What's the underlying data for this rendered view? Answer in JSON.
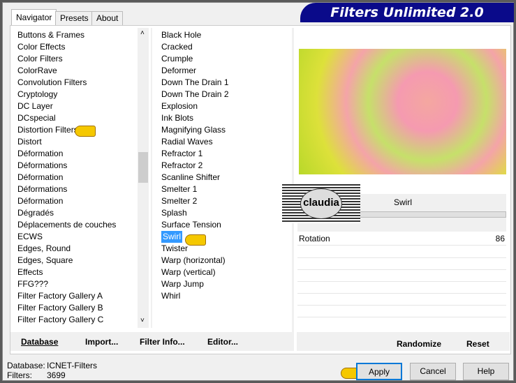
{
  "title": "Filters Unlimited 2.0",
  "tabs": [
    "Navigator",
    "Presets",
    "About"
  ],
  "categories": [
    "Buttons & Frames",
    "Color Effects",
    "Color Filters",
    "ColorRave",
    "Convolution Filters",
    "Cryptology",
    "DC Layer",
    "DCspecial",
    "Distortion Filters",
    "Distort",
    "Déformation",
    "Déformations",
    "Déformation",
    "Déformations",
    "Déformation",
    "Dégradés",
    "Déplacements de couches",
    "ECWS",
    "Edges, Round",
    "Edges, Square",
    "Effects",
    "FFG???",
    "Filter Factory Gallery A",
    "Filter Factory Gallery B",
    "Filter Factory Gallery C"
  ],
  "filters": [
    "Black Hole",
    "Cracked",
    "Crumple",
    "Deformer",
    "Down The Drain 1",
    "Down The Drain 2",
    "Explosion",
    "Ink Blots",
    "Magnifying Glass",
    "Radial Waves",
    "Refractor 1",
    "Refractor 2",
    "Scanline Shifter",
    "Smelter 1",
    "Smelter 2",
    "Splash",
    "Surface Tension",
    "Swirl",
    "Twister",
    "Warp (horizontal)",
    "Warp (vertical)",
    "Warp Jump",
    "Whirl"
  ],
  "selected_filter_index": 17,
  "filter_name": "Swirl",
  "params": [
    {
      "label": "Rotation",
      "value": "86"
    }
  ],
  "watermark": "claudia",
  "buttons": {
    "database": "Database",
    "import": "Import...",
    "filter_info": "Filter Info...",
    "editor": "Editor...",
    "randomize": "Randomize",
    "reset": "Reset",
    "apply": "Apply",
    "cancel": "Cancel",
    "help": "Help"
  },
  "status": {
    "database_label": "Database:",
    "database_value": "ICNET-Filters",
    "filters_label": "Filters:",
    "filters_value": "3699"
  }
}
